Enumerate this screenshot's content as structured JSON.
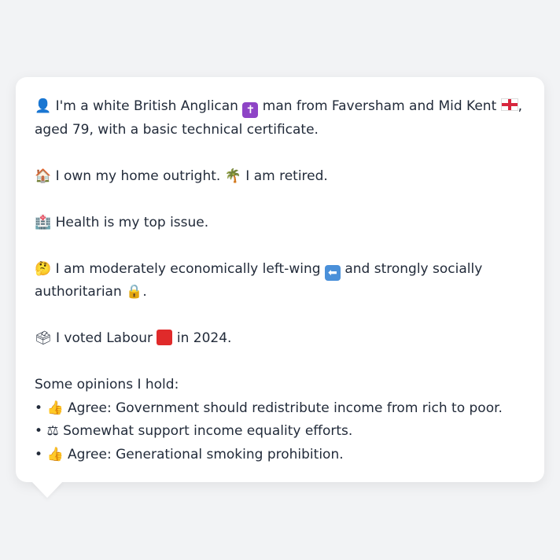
{
  "message": {
    "line1_a": "I'm a white British Anglican",
    "line1_b": "man from Faversham and Mid Kent",
    "line1_c": ",",
    "line2": "aged 79, with a basic technical certificate.",
    "home_a": "I own my home outright.",
    "home_b": "I am retired.",
    "health": "Health is my top issue.",
    "politics_a": "I am moderately economically left-wing",
    "politics_b": "and strongly socially",
    "politics_c": "authoritarian",
    "politics_d": ".",
    "vote_a": "I voted Labour",
    "vote_b": "in 2024.",
    "opinions_heading": "Some opinions I hold:",
    "opinions": [
      {
        "bullet": "•",
        "icon": "thumbs-up-icon",
        "text": "Agree: Government should redistribute income from rich to poor."
      },
      {
        "bullet": "•",
        "icon": "scales-icon",
        "text": "Somewhat support income equality efforts."
      },
      {
        "bullet": "•",
        "icon": "thumbs-up-icon",
        "text": "Agree: Generational smoking prohibition."
      }
    ]
  },
  "icons": {
    "person": "👤",
    "cross": "✝",
    "house": "🏠",
    "palm": "🌴",
    "hospital": "🏥",
    "thinking": "🤔",
    "arrow_left": "⬅",
    "lock": "🔒",
    "ballot": "🗳",
    "thumbs_up": "👍",
    "scales": "⚖"
  },
  "colors": {
    "background": "#f2f3f5",
    "bubble": "#ffffff",
    "text": "#222b3a"
  }
}
